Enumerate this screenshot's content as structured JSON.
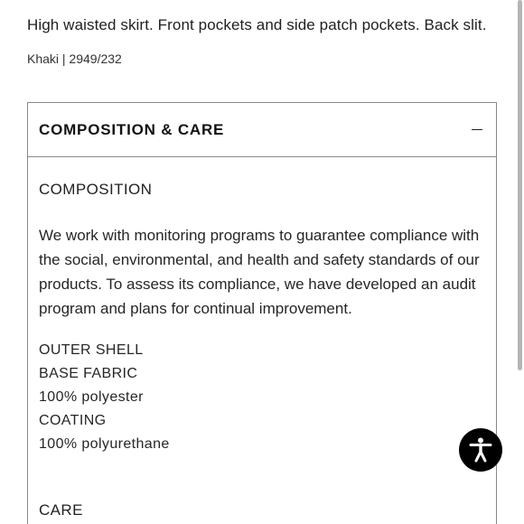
{
  "product": {
    "description": "High waisted skirt. Front pockets and side patch pockets. Back slit.",
    "sku_line": "Khaki | 2949/232"
  },
  "accordion": {
    "title": "COMPOSITION & CARE",
    "toggle_icon": "minus-icon",
    "composition": {
      "heading": "COMPOSITION",
      "paragraph_lines": [
        "We work with monitoring programs to guarantee compliance with",
        "the social, environmental, and health and safety standards of our",
        "products. To assess its compliance, we have developed an audit",
        "program and plans for continual improvement."
      ],
      "specs": [
        "OUTER SHELL",
        "BASE FABRIC",
        "100% polyester",
        "COATING",
        "100% polyurethane"
      ]
    },
    "care": {
      "heading": "CARE"
    }
  },
  "accessibility_button": {
    "icon": "accessibility-icon",
    "color": "#000000"
  }
}
